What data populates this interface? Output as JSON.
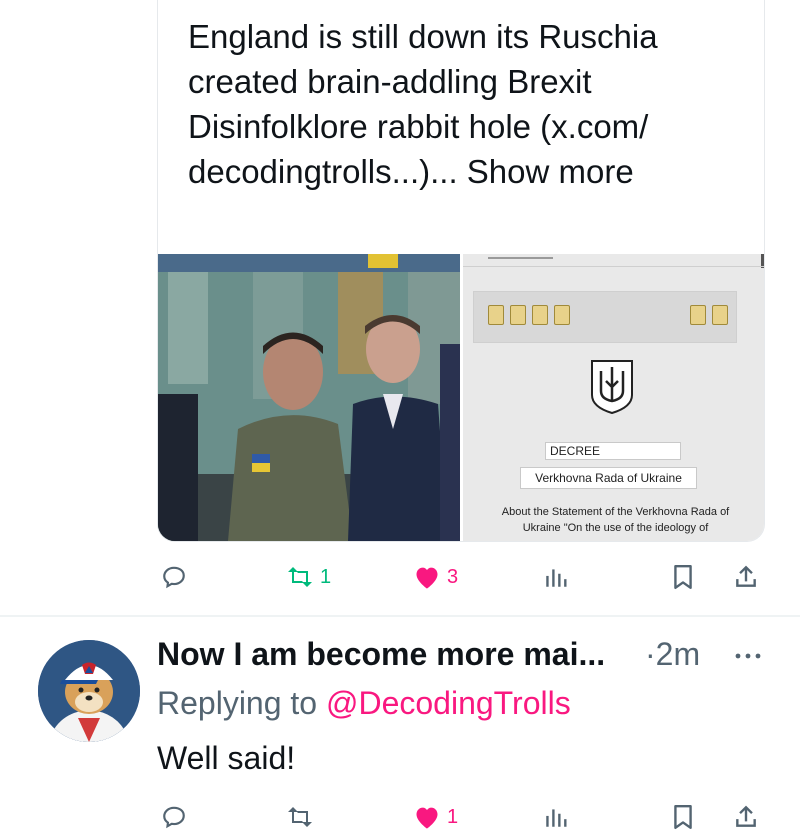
{
  "quote": {
    "text": "England is still down its Ruschia created brain-addling Brexit Disinfolklore rabbit hole (x.com/ decodingtrolls...)...",
    "show_more": "Show more",
    "doc": {
      "heading": "DECREE",
      "body_title": "Verkhovna Rada of Ukraine",
      "paragraph": "About the Statement of the Verkhovna Rada of Ukraine \"On the use of the ideology of"
    }
  },
  "tweet_actions": {
    "retweets": "1",
    "likes": "3"
  },
  "reply": {
    "author": "Now I am become more mai...",
    "separator": "·",
    "time": "2m",
    "replying_prefix": "Replying to",
    "replying_handle": "@DecodingTrolls",
    "text": "Well said!",
    "likes": "1"
  },
  "colors": {
    "retweet": "#00ba7c",
    "like": "#f91880",
    "secondary_text": "#536471"
  }
}
